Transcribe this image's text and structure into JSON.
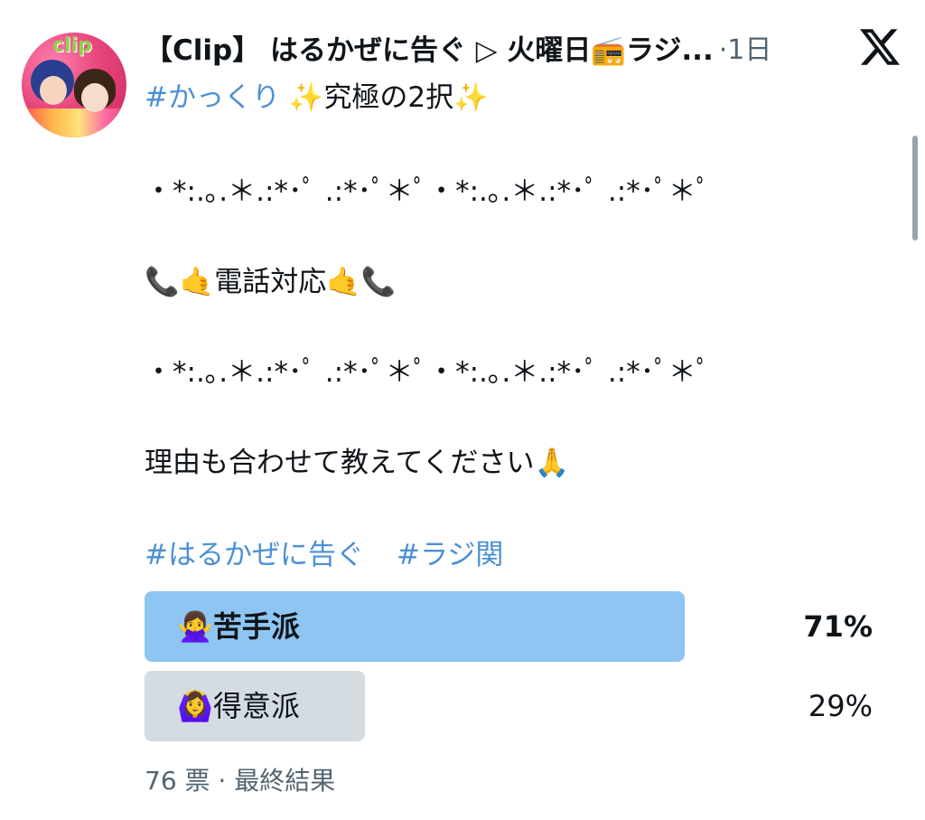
{
  "tweet": {
    "display_name": "【Clip】 はるかぜに告ぐ ▷ 火曜日📻ラジ...",
    "time": "·1日",
    "avatar_logo": "clip",
    "first_line_hashtag": "#かっくり",
    "first_line_rest": " ✨究極の2択✨",
    "divider_1": "・*:.｡.＊.:*･ﾟ .:*･ﾟ＊ﾟ・*:.｡.＊.:*･ﾟ .:*･ﾟ＊ﾟ",
    "topic": "📞🤙電話対応🤙📞",
    "divider_2": "・*:.｡.＊.:*･ﾟ .:*･ﾟ＊ﾟ・*:.｡.＊.:*･ﾟ .:*･ﾟ＊ﾟ",
    "request": "理由も合わせて教えてください🙏",
    "hashtag_1": "#はるかぜに告ぐ",
    "hashtag_2": "#ラジ関"
  },
  "poll": {
    "options": [
      {
        "label": "🙅‍♀️苦手派",
        "percent_text": "71%",
        "fraction": 0.71,
        "winner": true
      },
      {
        "label": "🙆‍♀️得意派",
        "percent_text": "29%",
        "fraction": 0.29,
        "winner": false
      }
    ],
    "footer": "76 票 · 最終結果"
  },
  "colors": {
    "winner_bar": "#8ec5f2",
    "other_bar": "#d4dbe1",
    "link": "#4a90d6",
    "muted": "#536471"
  },
  "icons": {
    "x_logo": "x-logo-icon",
    "avatar": "avatar"
  }
}
